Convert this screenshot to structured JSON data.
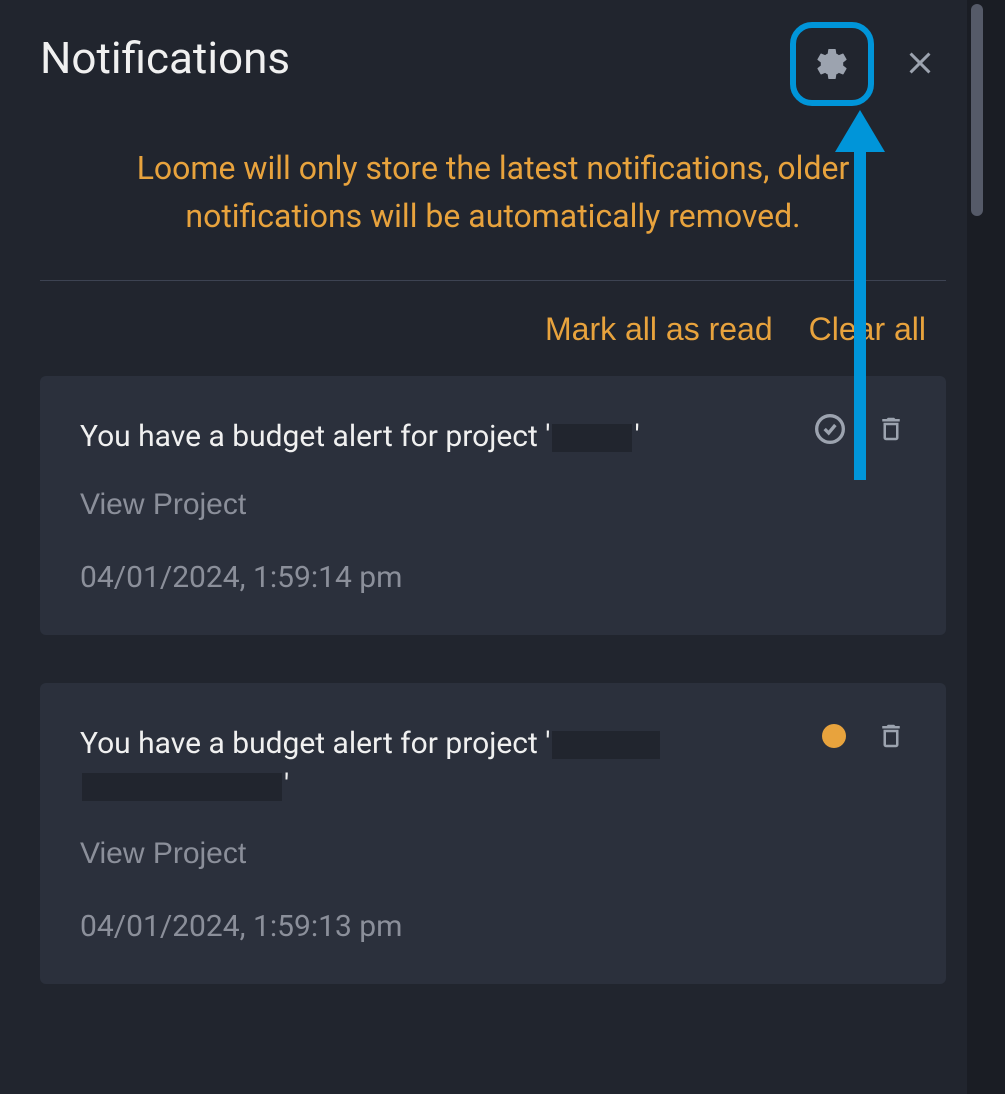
{
  "header": {
    "title": "Notifications"
  },
  "info": {
    "text": "Loome will only store the latest notifications, older notifications will be automatically removed."
  },
  "actions": {
    "mark_all_read": "Mark all as read",
    "clear_all": "Clear all"
  },
  "notifications": [
    {
      "message_prefix": "You have a budget alert for project '",
      "message_suffix": "'",
      "link_label": "View Project",
      "timestamp": "04/01/2024, 1:59:14 pm",
      "read": true
    },
    {
      "message_prefix": "You have a budget alert for project '",
      "message_suffix": "'",
      "link_label": "View Project",
      "timestamp": "04/01/2024, 1:59:13 pm",
      "read": false
    }
  ],
  "colors": {
    "accent": "#e8a33d",
    "highlight_border": "#0095d9",
    "background": "#21252e",
    "card_background": "#2b303c"
  }
}
